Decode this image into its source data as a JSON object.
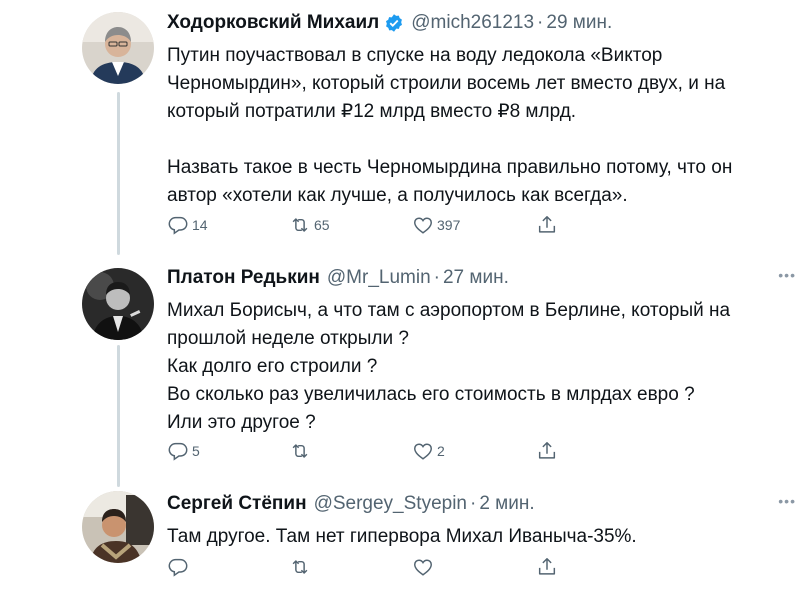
{
  "tweets": [
    {
      "name": "Ходорковский Михаил",
      "verified": true,
      "handle": "@mich261213",
      "time": "29 мин.",
      "lines": [
        "Путин поучаствовал в спуске на воду ледокола «Виктор",
        "Черномырдин», который строили восемь лет вместо двух, и на",
        "который потратили ₽12 млрд вместо ₽8 млрд.",
        "",
        "Назвать такое в честь Черномырдина правильно потому, что он",
        "автор «хотели как лучше, а получилось как всегда»."
      ],
      "replies": "14",
      "retweets": "65",
      "likes": "397"
    },
    {
      "name": "Платон Редькин",
      "verified": false,
      "handle": "@Mr_Lumin",
      "time": "27 мин.",
      "lines": [
        "Михал Борисыч, а что там с аэропортом в Берлине, который на",
        "прошлой неделе открыли ?",
        "Как долго его строили ?",
        "Во сколько раз увеличилась его стоимость в млрдах евро ?",
        "Или это другое ?"
      ],
      "replies": "5",
      "retweets": "",
      "likes": "2"
    },
    {
      "name": "Сергей Стёпин",
      "verified": false,
      "handle": "@Sergey_Styepin",
      "time": "2 мин.",
      "lines": [
        "Там другое. Там нет гипервора Михал Иваныча-35%."
      ],
      "replies": "",
      "retweets": "",
      "likes": ""
    }
  ],
  "separator": "·",
  "icons": {
    "reply": "reply-icon",
    "retweet": "retweet-icon",
    "like": "like-icon",
    "share": "share-icon",
    "more": "more-icon",
    "verified": "verified-badge-icon"
  },
  "colors": {
    "text": "#0f1419",
    "secondary": "#536471",
    "verified": "#1d9bf0",
    "thread_line": "#cfd9de"
  }
}
